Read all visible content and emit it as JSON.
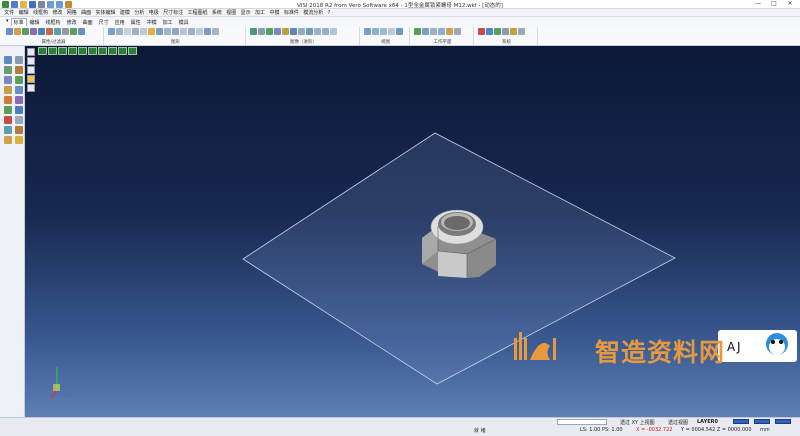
{
  "window": {
    "title": "VISI 2018 R2 from Vero Software x64 - 1型全金属锁紧螺母 M12.wkf - [动态的]",
    "controls": [
      "—",
      "□",
      "✕"
    ]
  },
  "menu": [
    "文件",
    "编辑",
    "线框构",
    "修改",
    "网格",
    "曲面",
    "实体编辑",
    "建模",
    "分析",
    "电极",
    "尺寸标注",
    "工程图纸",
    "系统",
    "视图",
    "显示",
    "加工",
    "中模",
    "标准件",
    "模流分析",
    "?"
  ],
  "tabs": {
    "collapse": "▾",
    "items": [
      "标准",
      "编辑",
      "线框构",
      "修改",
      "曲面",
      "尺寸",
      "应用",
      "属性",
      "冲模",
      "加工",
      "模具"
    ],
    "active_index": 0
  },
  "ribbon_groups": [
    {
      "label": "属性/过滤器"
    },
    {
      "label": "图形"
    },
    {
      "label": "图像（进阶）"
    },
    {
      "label": "视图"
    },
    {
      "label": "工作平面"
    },
    {
      "label": "系统"
    }
  ],
  "watermark": {
    "text": "智造资料网"
  },
  "status": {
    "left_label": "就 绪",
    "view_top": "透过 XY 上视图",
    "view_plane": "透过视图",
    "layer_label": "LAYER0",
    "scale": "LS: 1.00  PS: 1.00",
    "coords_x": "X = -0032.722",
    "coords_rest": "Y = 0004.542  Z = 0000.000",
    "unit": "mm"
  },
  "colors": {
    "accent": "#2f62b3",
    "viewport_top": "#0d1838",
    "viewport_bottom": "#5e7fb4",
    "watermark": "#e69a3d"
  }
}
